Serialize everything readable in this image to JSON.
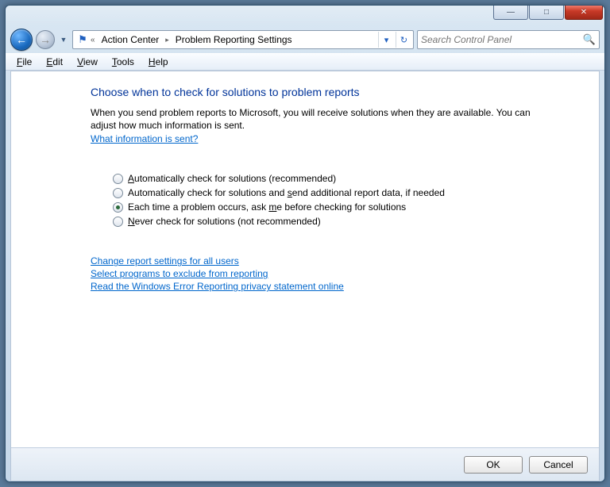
{
  "titlebar": {
    "minimize": "—",
    "maximize": "□",
    "close": "✕"
  },
  "nav": {
    "back_glyph": "←",
    "fwd_glyph": "→",
    "dropdown_glyph": "▼"
  },
  "address": {
    "chevrons": "«",
    "crumb1": "Action Center",
    "crumb2": "Problem Reporting Settings",
    "sep": "▸",
    "dropdown": "▾",
    "refresh": "↻"
  },
  "search": {
    "placeholder": "Search Control Panel",
    "icon": "🔍"
  },
  "menu": {
    "file": {
      "u": "F",
      "rest": "ile"
    },
    "edit": {
      "u": "E",
      "rest": "dit"
    },
    "view": {
      "u": "V",
      "rest": "iew"
    },
    "tools": {
      "u": "T",
      "rest": "ools"
    },
    "help": {
      "u": "H",
      "rest": "elp"
    }
  },
  "content": {
    "heading": "Choose when to check for solutions to problem reports",
    "body": "When you send problem reports to Microsoft, you will receive solutions when they are available. You can adjust how much information is sent.",
    "info_link": "What information is sent?",
    "radios": [
      {
        "pre": "",
        "u": "A",
        "post": "utomatically check for solutions (recommended)",
        "checked": false
      },
      {
        "pre": "Automatically check for solutions and ",
        "u": "s",
        "post": "end additional report data, if needed",
        "checked": false
      },
      {
        "pre": "Each time a problem occurs, ask ",
        "u": "m",
        "post": "e before checking for solutions",
        "checked": true
      },
      {
        "pre": "",
        "u": "N",
        "post": "ever check for solutions (not recommended)",
        "checked": false
      }
    ],
    "links": {
      "l1": {
        "pre": "Change report settings for all ",
        "u": "u",
        "post": "sers"
      },
      "l2": {
        "pre": "Select ",
        "u": "p",
        "post": "rograms to exclude from reporting"
      },
      "l3": {
        "pre": "",
        "u": "R",
        "post": "ead the Windows Error Reporting privacy statement online"
      }
    }
  },
  "buttons": {
    "ok": "OK",
    "cancel": "Cancel"
  }
}
